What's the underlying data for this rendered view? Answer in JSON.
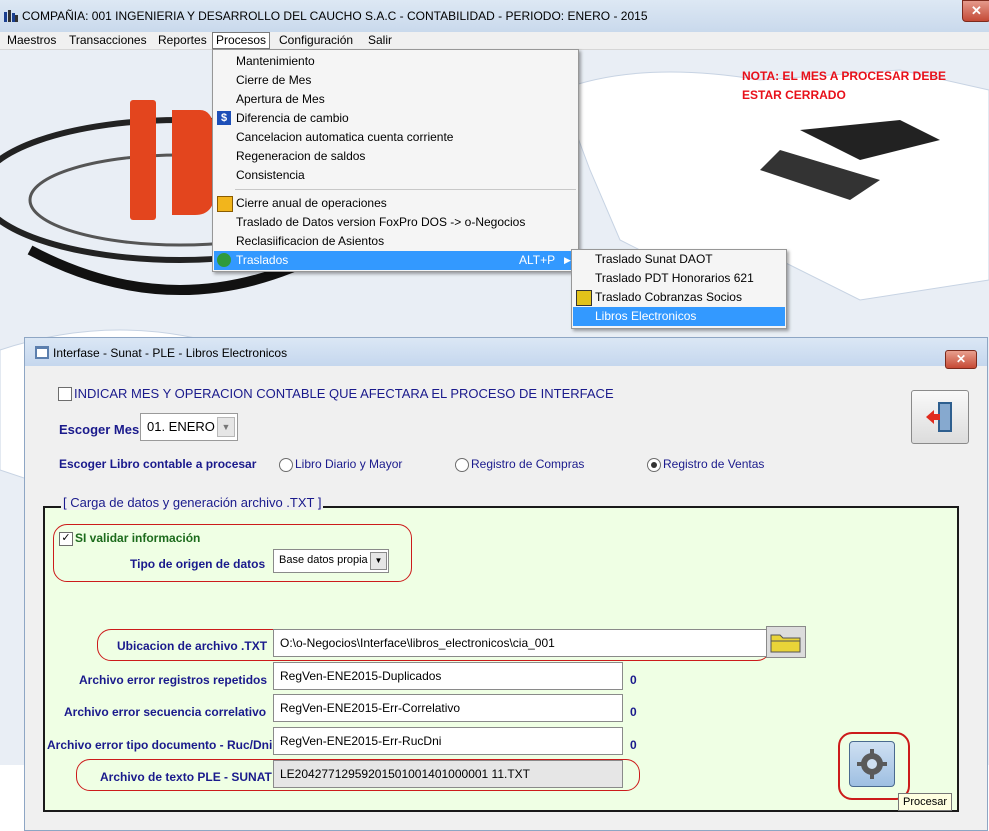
{
  "window": {
    "title": "COMPAÑIA:  001 INGENIERIA Y DESARROLLO DEL CAUCHO S.A.C    -    CONTABILIDAD    -    PERIODO: ENERO - 2015",
    "close": "✕"
  },
  "menubar": [
    "Maestros",
    "Transacciones",
    "Reportes",
    "Procesos",
    "Configuración",
    "Salir"
  ],
  "procesos_menu": {
    "items": [
      "Mantenimiento",
      "Cierre de Mes",
      "Apertura de Mes",
      "Diferencia de cambio",
      "Cancelacion automatica cuenta corriente",
      "Regeneracion de saldos",
      "Consistencia",
      "Cierre anual de operaciones",
      "Traslado de Datos version FoxPro DOS  -> o-Negocios",
      "Reclasiificacion de Asientos",
      "Traslados"
    ],
    "traslados_shortcut": "ALT+P"
  },
  "traslados_submenu": [
    "Traslado Sunat DAOT",
    "Traslado PDT Honorarios 621",
    "Traslado Cobranzas Socios",
    "Libros Electronicos"
  ],
  "note": {
    "line1": "NOTA: EL MES A PROCESAR DEBE",
    "line2": "ESTAR CERRADO",
    "color": "#e8101a"
  },
  "dialog": {
    "title": "Interfase - Sunat - PLE - Libros Electronicos",
    "close": "✕",
    "indicate_label": "INDICAR MES Y OPERACION CONTABLE QUE AFECTARA EL PROCESO DE INTERFACE",
    "mes_label": "Escoger Mes",
    "mes_value": "01. ENERO",
    "libro_label": "Escoger Libro contable a procesar",
    "libro_options": [
      "Libro Diario y Mayor",
      "Registro de Compras",
      "Registro de Ventas"
    ],
    "libro_selected": "Registro de Ventas",
    "group_title": "[ Carga de datos y generación archivo  .TXT ]",
    "validar_label": "SI validar información",
    "origen_label": "Tipo de origen de datos",
    "origen_value": "Base datos propia",
    "ubicacion_label": "Ubicacion de archivo .TXT",
    "ubicacion_value": "O:\\o-Negocios\\Interface\\libros_electronicos\\cia_001",
    "err_repetidos_label": "Archivo error registros repetidos",
    "err_repetidos_value": "RegVen-ENE2015-Duplicados",
    "err_repetidos_count": "0",
    "err_secuencia_label": "Archivo error secuencia correlativo",
    "err_secuencia_value": "RegVen-ENE2015-Err-Correlativo",
    "err_secuencia_count": "0",
    "err_tipo_label": "Archivo error tipo documento - Ruc/Dni",
    "err_tipo_value": "RegVen-ENE2015-Err-RucDni",
    "err_tipo_count": "0",
    "ple_label": "Archivo de texto PLE - SUNAT",
    "ple_value": "LE20427712959201501001401000001 11.TXT",
    "tooltip": "Procesar"
  }
}
